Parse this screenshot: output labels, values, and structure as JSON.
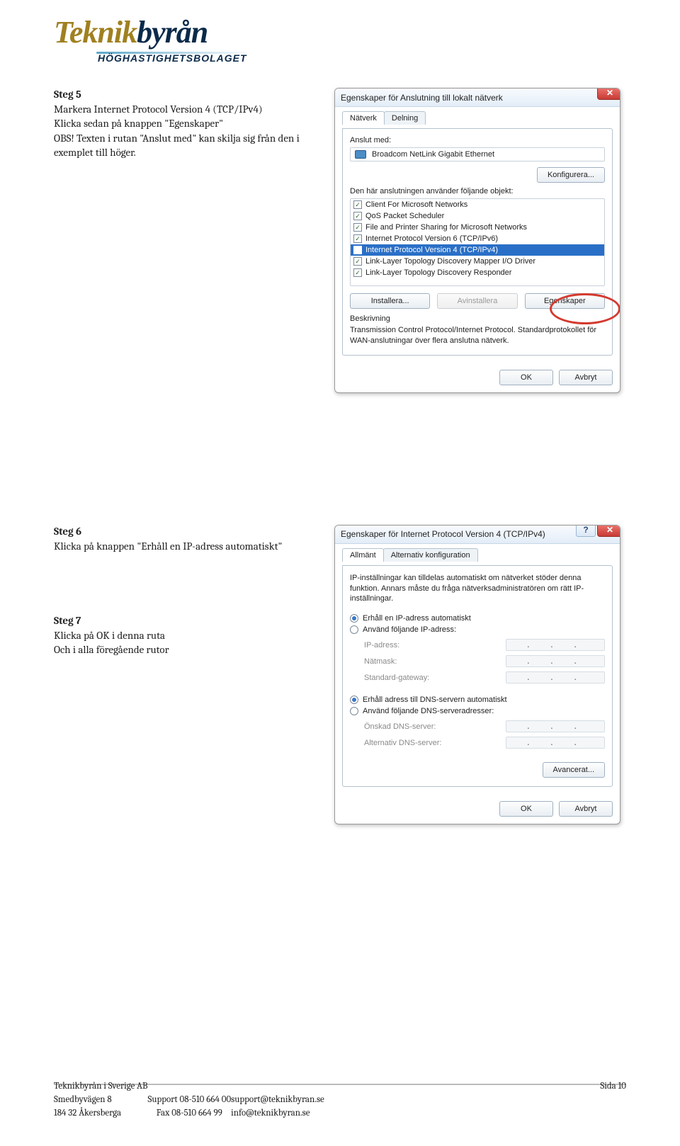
{
  "logo": {
    "part1": "Teknik",
    "part2": "byrån",
    "sub": "HÖGHASTIGHETSBOLAGET"
  },
  "steps": {
    "s5": {
      "head": "Steg 5",
      "l1": "Markera Internet Protocol Version 4 (TCP/IPv4)",
      "l2": "Klicka sedan på knappen \"Egenskaper\"",
      "l3": "OBS! Texten i rutan \"Anslut med\" kan skilja sig från den i exemplet till höger."
    },
    "s6": {
      "head": "Steg 6",
      "l1": "Klicka på knappen \"Erhåll en IP-adress automatiskt\""
    },
    "s7": {
      "head": "Steg 7",
      "l1": "Klicka på OK i denna ruta",
      "l2": "Och i alla föregående rutor"
    }
  },
  "dlg1": {
    "title": "Egenskaper för Anslutning till lokalt nätverk",
    "tabs": {
      "t1": "Nätverk",
      "t2": "Delning"
    },
    "anslut_lbl": "Anslut med:",
    "adapter": "Broadcom NetLink Gigabit Ethernet",
    "cfg_btn": "Konfigurera...",
    "list_lbl": "Den här anslutningen använder följande objekt:",
    "items": [
      "Client For Microsoft Networks",
      "QoS Packet Scheduler",
      "File and Printer Sharing for Microsoft Networks",
      "Internet Protocol Version 6 (TCP/IPv6)",
      "Internet Protocol Version 4 (TCP/IPv4)",
      "Link-Layer Topology Discovery Mapper I/O Driver",
      "Link-Layer Topology Discovery Responder"
    ],
    "btns": {
      "install": "Installera...",
      "uninstall": "Avinstallera",
      "props": "Egenskaper"
    },
    "desc_lbl": "Beskrivning",
    "desc": "Transmission Control Protocol/Internet Protocol. Standardprotokollet för WAN-anslutningar över flera anslutna nätverk.",
    "ok": "OK",
    "cancel": "Avbryt"
  },
  "dlg2": {
    "title": "Egenskaper för Internet Protocol Version 4 (TCP/IPv4)",
    "tabs": {
      "t1": "Allmänt",
      "t2": "Alternativ konfiguration"
    },
    "intro": "IP-inställningar kan tilldelas automatiskt om nätverket stöder denna funktion. Annars måste du fråga nätverksadministratören om rätt IP-inställningar.",
    "r1": "Erhåll en IP-adress automatiskt",
    "r2": "Använd följande IP-adress:",
    "ip_lbl": "IP-adress:",
    "mask_lbl": "Nätmask:",
    "gw_lbl": "Standard-gateway:",
    "r3": "Erhåll adress till DNS-servern automatiskt",
    "r4": "Använd följande DNS-serveradresser:",
    "dns1_lbl": "Önskad DNS-server:",
    "dns2_lbl": "Alternativ DNS-server:",
    "adv": "Avancerat...",
    "ok": "OK",
    "cancel": "Avbryt"
  },
  "footer": {
    "company": "Teknikbyrån i Sverige AB",
    "addr1": "Smedbyvägen 8",
    "addr2": "184 32 Åkersberga",
    "support": "Support 08-510 664 00",
    "fax": "Fax 08-510 664 99",
    "email1": "support@teknikbyran.se",
    "email2": "info@teknikbyran.se",
    "page": "Sida 10"
  }
}
